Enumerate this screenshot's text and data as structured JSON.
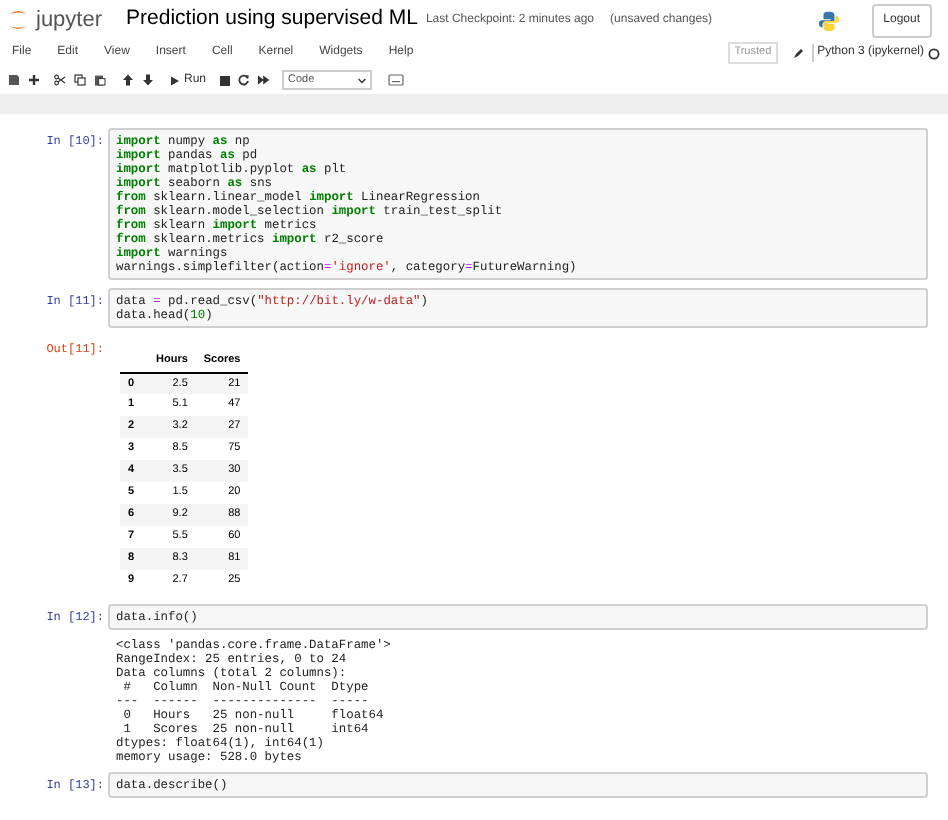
{
  "header": {
    "logo_text": "jupyter",
    "title": "Prediction using supervised ML",
    "checkpoint": "Last Checkpoint: 2 minutes ago",
    "save_status": "(unsaved changes)",
    "logout": "Logout"
  },
  "menu": [
    "File",
    "Edit",
    "View",
    "Insert",
    "Cell",
    "Kernel",
    "Widgets",
    "Help"
  ],
  "kernel_area": {
    "trusted": "Trusted",
    "kernel": "Python 3 (ipykernel)"
  },
  "toolbar": {
    "run_label": "Run",
    "cell_type": "Code"
  },
  "cells": [
    {
      "kind": "code",
      "prompt": "In [10]:",
      "lines": [
        [
          {
            "kind": "keyword",
            "text": "import"
          },
          {
            "kind": "plain",
            "text": " numpy "
          },
          {
            "kind": "keyword",
            "text": "as"
          },
          {
            "kind": "plain",
            "text": " np"
          }
        ],
        [
          {
            "kind": "keyword",
            "text": "import"
          },
          {
            "kind": "plain",
            "text": " pandas "
          },
          {
            "kind": "keyword",
            "text": "as"
          },
          {
            "kind": "plain",
            "text": " pd"
          }
        ],
        [
          {
            "kind": "keyword",
            "text": "import"
          },
          {
            "kind": "plain",
            "text": " matplotlib.pyplot "
          },
          {
            "kind": "keyword",
            "text": "as"
          },
          {
            "kind": "plain",
            "text": " plt"
          }
        ],
        [
          {
            "kind": "keyword",
            "text": "import"
          },
          {
            "kind": "plain",
            "text": " seaborn "
          },
          {
            "kind": "keyword",
            "text": "as"
          },
          {
            "kind": "plain",
            "text": " sns"
          }
        ],
        [
          {
            "kind": "keyword",
            "text": "from"
          },
          {
            "kind": "plain",
            "text": " sklearn.linear_model "
          },
          {
            "kind": "keyword",
            "text": "import"
          },
          {
            "kind": "plain",
            "text": " LinearRegression"
          }
        ],
        [
          {
            "kind": "keyword",
            "text": "from"
          },
          {
            "kind": "plain",
            "text": " sklearn.model_selection "
          },
          {
            "kind": "keyword",
            "text": "import"
          },
          {
            "kind": "plain",
            "text": " train_test_split"
          }
        ],
        [
          {
            "kind": "keyword",
            "text": "from"
          },
          {
            "kind": "plain",
            "text": " sklearn "
          },
          {
            "kind": "keyword",
            "text": "import"
          },
          {
            "kind": "plain",
            "text": " metrics"
          }
        ],
        [
          {
            "kind": "keyword",
            "text": "from"
          },
          {
            "kind": "plain",
            "text": " sklearn.metrics "
          },
          {
            "kind": "keyword",
            "text": "import"
          },
          {
            "kind": "plain",
            "text": " r2_score"
          }
        ],
        [
          {
            "kind": "keyword",
            "text": "import"
          },
          {
            "kind": "plain",
            "text": " warnings"
          }
        ],
        [
          {
            "kind": "plain",
            "text": "warnings.simplefilter(action"
          },
          {
            "kind": "operator",
            "text": "="
          },
          {
            "kind": "string",
            "text": "'ignore'"
          },
          {
            "kind": "plain",
            "text": ", category"
          },
          {
            "kind": "operator",
            "text": "="
          },
          {
            "kind": "plain",
            "text": "FutureWarning)"
          }
        ]
      ]
    },
    {
      "kind": "code",
      "prompt": "In [11]:",
      "lines": [
        [
          {
            "kind": "plain",
            "text": "data "
          },
          {
            "kind": "operator",
            "text": "="
          },
          {
            "kind": "plain",
            "text": " pd.read_csv("
          },
          {
            "kind": "string",
            "text": "\"http://bit.ly/w-data\""
          },
          {
            "kind": "plain",
            "text": ")"
          }
        ],
        [
          {
            "kind": "plain",
            "text": "data.head("
          },
          {
            "kind": "number",
            "text": "10"
          },
          {
            "kind": "plain",
            "text": ")"
          }
        ]
      ]
    },
    {
      "kind": "table_output",
      "prompt": "Out[11]:",
      "columns": [
        "",
        "Hours",
        "Scores"
      ],
      "rows": [
        [
          "0",
          "2.5",
          "21"
        ],
        [
          "1",
          "5.1",
          "47"
        ],
        [
          "2",
          "3.2",
          "27"
        ],
        [
          "3",
          "8.5",
          "75"
        ],
        [
          "4",
          "3.5",
          "30"
        ],
        [
          "5",
          "1.5",
          "20"
        ],
        [
          "6",
          "9.2",
          "88"
        ],
        [
          "7",
          "5.5",
          "60"
        ],
        [
          "8",
          "8.3",
          "81"
        ],
        [
          "9",
          "2.7",
          "25"
        ]
      ]
    },
    {
      "kind": "code",
      "prompt": "In [12]:",
      "lines": [
        [
          {
            "kind": "plain",
            "text": "data.info()"
          }
        ]
      ]
    },
    {
      "kind": "text_output",
      "lines": [
        "<class 'pandas.core.frame.DataFrame'>",
        "RangeIndex: 25 entries, 0 to 24",
        "Data columns (total 2 columns):",
        " #   Column  Non-Null Count  Dtype",
        "---  ------  --------------  -----",
        " 0   Hours   25 non-null     float64",
        " 1   Scores  25 non-null     int64",
        "dtypes: float64(1), int64(1)",
        "memory usage: 528.0 bytes"
      ]
    },
    {
      "kind": "code",
      "prompt": "In [13]:",
      "lines": [
        [
          {
            "kind": "plain",
            "text": "data.describe()"
          }
        ]
      ]
    }
  ]
}
